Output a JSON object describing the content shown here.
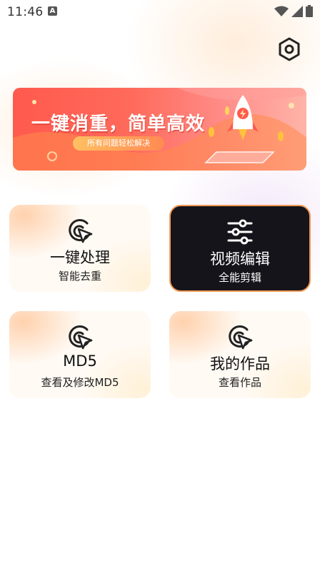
{
  "status_bar": {
    "time": "11:46",
    "notification_icon": "a-icon"
  },
  "header": {
    "settings_icon": "hexagon-gear-icon"
  },
  "banner": {
    "title": "一键消重，简单高效",
    "subtitle": "所有问题轻松解决"
  },
  "cards": [
    {
      "title": "一键处理",
      "subtitle": "智能去重",
      "icon": "cursor-click-icon"
    },
    {
      "title": "视频编辑",
      "subtitle": "全能剪辑",
      "icon": "sliders-icon"
    },
    {
      "title": "MD5",
      "subtitle": "查看及修改MD5",
      "icon": "cursor-click-icon"
    },
    {
      "title": "我的作品",
      "subtitle": "查看作品",
      "icon": "cursor-click-icon"
    }
  ],
  "colors": {
    "accent": "#f39a56",
    "dark_card": "#15141a",
    "banner_red": "#ff5a4e"
  }
}
